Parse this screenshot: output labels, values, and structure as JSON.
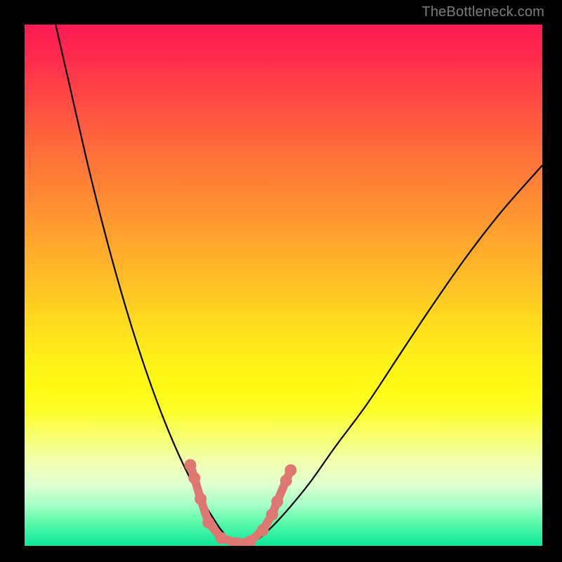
{
  "attribution": "TheBottleneck.com",
  "colors": {
    "frame": "#000000",
    "gradient_top": "#ff1a55",
    "gradient_mid": "#fff018",
    "gradient_bottom": "#0de89a",
    "curve": "#000000",
    "marker": "#de776f"
  },
  "chart_data": {
    "type": "line",
    "title": "",
    "xlabel": "",
    "ylabel": "",
    "xlim": [
      0,
      100
    ],
    "ylim": [
      0,
      100
    ],
    "note": "Two curves descending into a V-shaped minimum near x≈38, with salmon markers along the trough.",
    "series": [
      {
        "name": "left-curve",
        "x": [
          6,
          9,
          12,
          15,
          18,
          21,
          24,
          27,
          30,
          33,
          36,
          38,
          40,
          43
        ],
        "y": [
          100,
          87,
          74,
          62,
          51,
          41,
          32,
          24,
          17,
          11,
          6,
          3,
          1,
          0
        ]
      },
      {
        "name": "right-curve",
        "x": [
          43,
          46,
          50,
          55,
          60,
          66,
          72,
          78,
          85,
          92,
          100
        ],
        "y": [
          0,
          2,
          6,
          12,
          19,
          27,
          36,
          45,
          55,
          64,
          73
        ]
      }
    ],
    "markers": {
      "name": "trough-markers",
      "points": [
        {
          "x": 32.0,
          "y": 15.5
        },
        {
          "x": 32.8,
          "y": 13.0
        },
        {
          "x": 34.0,
          "y": 9.0
        },
        {
          "x": 35.5,
          "y": 4.5
        },
        {
          "x": 38.0,
          "y": 1.5
        },
        {
          "x": 41.0,
          "y": 0.5
        },
        {
          "x": 43.5,
          "y": 0.8
        },
        {
          "x": 46.0,
          "y": 3.0
        },
        {
          "x": 47.8,
          "y": 6.0
        },
        {
          "x": 48.8,
          "y": 8.5
        },
        {
          "x": 50.5,
          "y": 12.5
        },
        {
          "x": 51.4,
          "y": 14.5
        }
      ]
    }
  }
}
